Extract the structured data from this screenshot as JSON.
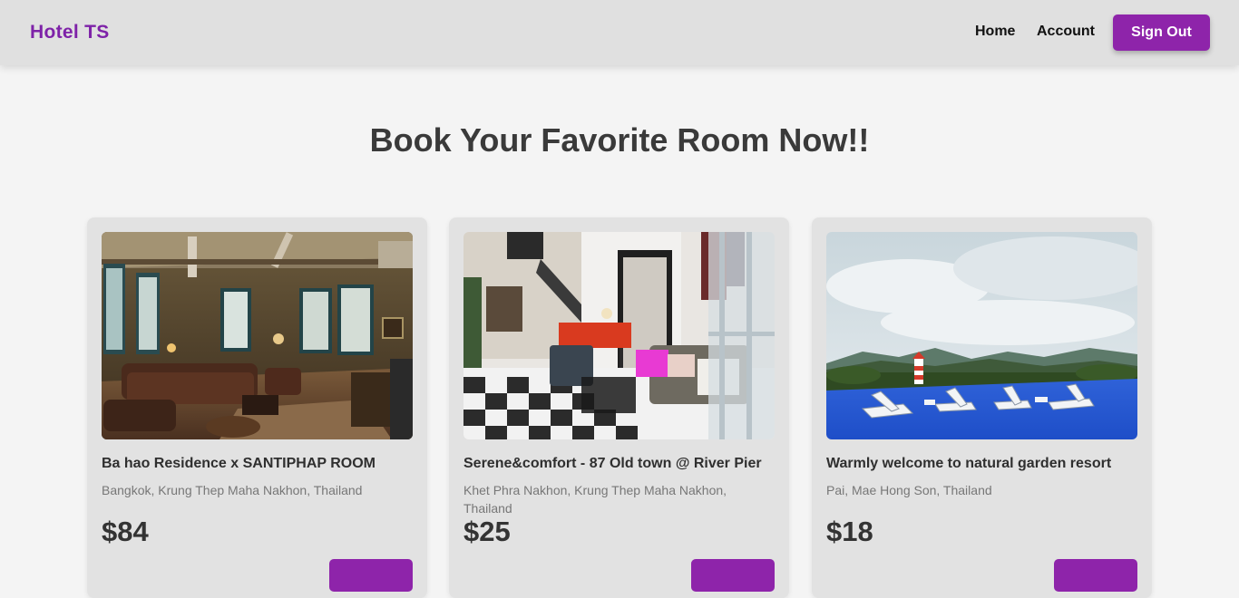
{
  "navbar": {
    "brand": "Hotel TS",
    "links": [
      {
        "label": "Home"
      },
      {
        "label": "Account"
      }
    ],
    "signout_label": "Sign Out"
  },
  "hero": {
    "title": "Book Your Favorite Room Now!!"
  },
  "rooms": [
    {
      "name": "Ba hao Residence x SANTIPHAP ROOM",
      "location": "Bangkok, Krung Thep Maha Nakhon, Thailand",
      "price": "$84",
      "button_label": "",
      "image": "living-room-photo"
    },
    {
      "name": "Serene&comfort - 87 Old town @ River Pier",
      "location": "Khet Phra Nakhon, Krung Thep Maha Nakhon, Thailand",
      "price": "$25",
      "button_label": "",
      "image": "lounge-interior-photo"
    },
    {
      "name": "Warmly welcome to natural garden resort",
      "location": "Pai, Mae Hong Son, Thailand",
      "price": "$18",
      "button_label": "",
      "image": "pool-mountain-view-photo"
    }
  ],
  "colors": {
    "accent": "#8e24aa",
    "brand": "#7e22a8",
    "navbar_bg": "#e0e0e0",
    "page_bg": "#f4f4f4",
    "card_bg": "#e2e2e2"
  }
}
